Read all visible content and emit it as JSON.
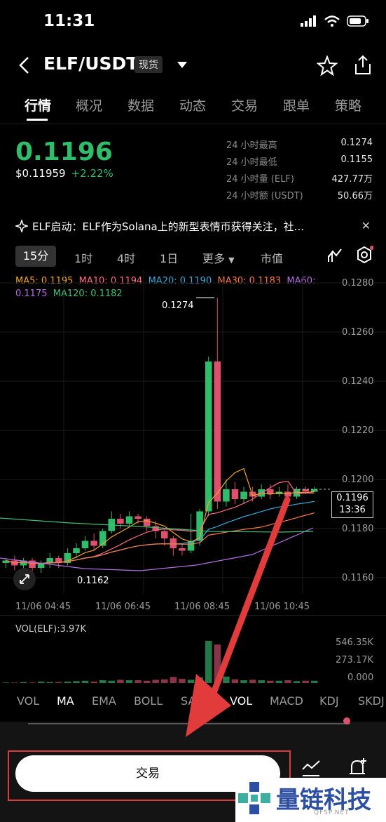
{
  "status": {
    "time": "11:31"
  },
  "header": {
    "pair": "ELF/USDT",
    "badge": "现货"
  },
  "tabs": [
    "行情",
    "概况",
    "数据",
    "动态",
    "交易",
    "跟单",
    "策略"
  ],
  "price": {
    "last": "0.1196",
    "usd": "$0.11959",
    "change": "+2.22%"
  },
  "stats": [
    {
      "label": "24 小时最高",
      "value": "0.1274"
    },
    {
      "label": "24 小时最低",
      "value": "0.1155"
    },
    {
      "label": "24 小时量 (ELF)",
      "value": "427.77万"
    },
    {
      "label": "24 小时额 (USDT)",
      "value": "50.66万"
    }
  ],
  "news": {
    "text": "ELF启动：ELF作为Solana上的新型表情币获得关注，社..."
  },
  "intervals": {
    "active": "15分",
    "items": [
      "1时",
      "4时",
      "1日",
      "更多",
      "市值"
    ]
  },
  "ma_legend": {
    "ma5": "MA5: 0.1195",
    "ma10": "MA10: 0.1194",
    "ma20": "MA20: 0.1190",
    "ma30": "MA30: 0.1183",
    "ma60": "MA60:",
    "ma60_val": "0.1175",
    "ma120": "MA120: 0.1182"
  },
  "colors": {
    "ma5": "#f5a623",
    "ma10": "#ff6b81",
    "ma20": "#3aa8d8",
    "ma30": "#ff7a45",
    "ma60": "#b56ee0",
    "ma120": "#3fbf72",
    "up": "#2ebd6b",
    "down": "#e0506e"
  },
  "chart_data": {
    "type": "candlestick",
    "y_ticks": [
      "0.1280",
      "0.1260",
      "0.1240",
      "0.1220",
      "0.1200",
      "0.1180",
      "0.1160"
    ],
    "ylim": [
      0.1155,
      0.1285
    ],
    "x_ticks": [
      "11/06 04:45",
      "11/06 06:45",
      "11/06 08:45",
      "11/06 10:45"
    ],
    "high_label": "0.1274",
    "low_label": "0.1162",
    "last_price_label": "0.1196",
    "countdown": "13:36",
    "candles": [
      {
        "o": 0.1166,
        "c": 0.1167,
        "h": 0.1168,
        "l": 0.1164
      },
      {
        "o": 0.1167,
        "c": 0.1165,
        "h": 0.1169,
        "l": 0.1163
      },
      {
        "o": 0.1165,
        "c": 0.1167,
        "h": 0.1168,
        "l": 0.1163
      },
      {
        "o": 0.1167,
        "c": 0.1164,
        "h": 0.1168,
        "l": 0.1162
      },
      {
        "o": 0.1164,
        "c": 0.1166,
        "h": 0.1167,
        "l": 0.1162
      },
      {
        "o": 0.1166,
        "c": 0.1168,
        "h": 0.117,
        "l": 0.1164
      },
      {
        "o": 0.1168,
        "c": 0.1166,
        "h": 0.1169,
        "l": 0.1164
      },
      {
        "o": 0.1166,
        "c": 0.117,
        "h": 0.1172,
        "l": 0.1165
      },
      {
        "o": 0.117,
        "c": 0.1172,
        "h": 0.1174,
        "l": 0.1168
      },
      {
        "o": 0.1172,
        "c": 0.1175,
        "h": 0.1177,
        "l": 0.1171
      },
      {
        "o": 0.1175,
        "c": 0.1173,
        "h": 0.1178,
        "l": 0.1171
      },
      {
        "o": 0.1173,
        "c": 0.1179,
        "h": 0.118,
        "l": 0.1172
      },
      {
        "o": 0.1179,
        "c": 0.1184,
        "h": 0.1187,
        "l": 0.1178
      },
      {
        "o": 0.1184,
        "c": 0.1182,
        "h": 0.1186,
        "l": 0.118
      },
      {
        "o": 0.1182,
        "c": 0.1185,
        "h": 0.1187,
        "l": 0.1181
      },
      {
        "o": 0.1185,
        "c": 0.1184,
        "h": 0.1186,
        "l": 0.1182
      },
      {
        "o": 0.1184,
        "c": 0.1181,
        "h": 0.1185,
        "l": 0.1179
      },
      {
        "o": 0.1181,
        "c": 0.1179,
        "h": 0.1183,
        "l": 0.1176
      },
      {
        "o": 0.1179,
        "c": 0.1176,
        "h": 0.118,
        "l": 0.1173
      },
      {
        "o": 0.1176,
        "c": 0.1172,
        "h": 0.1177,
        "l": 0.1169
      },
      {
        "o": 0.1172,
        "c": 0.1171,
        "h": 0.1174,
        "l": 0.1169
      },
      {
        "o": 0.1171,
        "c": 0.1175,
        "h": 0.1186,
        "l": 0.117
      },
      {
        "o": 0.1175,
        "c": 0.1187,
        "h": 0.1188,
        "l": 0.1173
      },
      {
        "o": 0.1187,
        "c": 0.1248,
        "h": 0.125,
        "l": 0.1185
      },
      {
        "o": 0.1248,
        "c": 0.1191,
        "h": 0.1274,
        "l": 0.1188
      },
      {
        "o": 0.1191,
        "c": 0.1196,
        "h": 0.12,
        "l": 0.1189
      },
      {
        "o": 0.1196,
        "c": 0.1192,
        "h": 0.1199,
        "l": 0.119
      },
      {
        "o": 0.1192,
        "c": 0.1195,
        "h": 0.1197,
        "l": 0.119
      },
      {
        "o": 0.1195,
        "c": 0.1193,
        "h": 0.1197,
        "l": 0.1191
      },
      {
        "o": 0.1193,
        "c": 0.1196,
        "h": 0.1198,
        "l": 0.1192
      },
      {
        "o": 0.1196,
        "c": 0.1194,
        "h": 0.1198,
        "l": 0.1192
      },
      {
        "o": 0.1194,
        "c": 0.1195,
        "h": 0.1197,
        "l": 0.1193
      },
      {
        "o": 0.1195,
        "c": 0.1193,
        "h": 0.1198,
        "l": 0.1192
      },
      {
        "o": 0.1193,
        "c": 0.1196,
        "h": 0.1197,
        "l": 0.1192
      },
      {
        "o": 0.1196,
        "c": 0.1195,
        "h": 0.1197,
        "l": 0.1194
      },
      {
        "o": 0.1195,
        "c": 0.1196,
        "h": 0.1197,
        "l": 0.1195
      }
    ]
  },
  "volume": {
    "label": "VOL(ELF):3.97K",
    "ticks": [
      "546.35K",
      "273.17K",
      "0.000"
    ],
    "bars": [
      0.01,
      0.01,
      0.02,
      0.01,
      0.03,
      0.02,
      0.02,
      0.03,
      0.04,
      0.05,
      0.03,
      0.06,
      0.05,
      0.07,
      0.06,
      0.06,
      0.05,
      0.07,
      0.08,
      0.13,
      0.09,
      0.07,
      0.12,
      0.91,
      0.83,
      0.14,
      0.08,
      0.06,
      0.07,
      0.06,
      0.05,
      0.05,
      0.06,
      0.04,
      0.05,
      0.05
    ]
  },
  "indicators": {
    "main": [
      "VOL",
      "MA",
      "EMA",
      "BOLL",
      "SAR"
    ],
    "sub": [
      "VOL",
      "MACD",
      "KDJ",
      "SKDJ"
    ],
    "main_active": "MA",
    "sub_active": "VOL"
  },
  "bottom": {
    "trade_label": "交易"
  },
  "watermark": {
    "text": "量链科技",
    "sub": "QFSP.NET"
  }
}
